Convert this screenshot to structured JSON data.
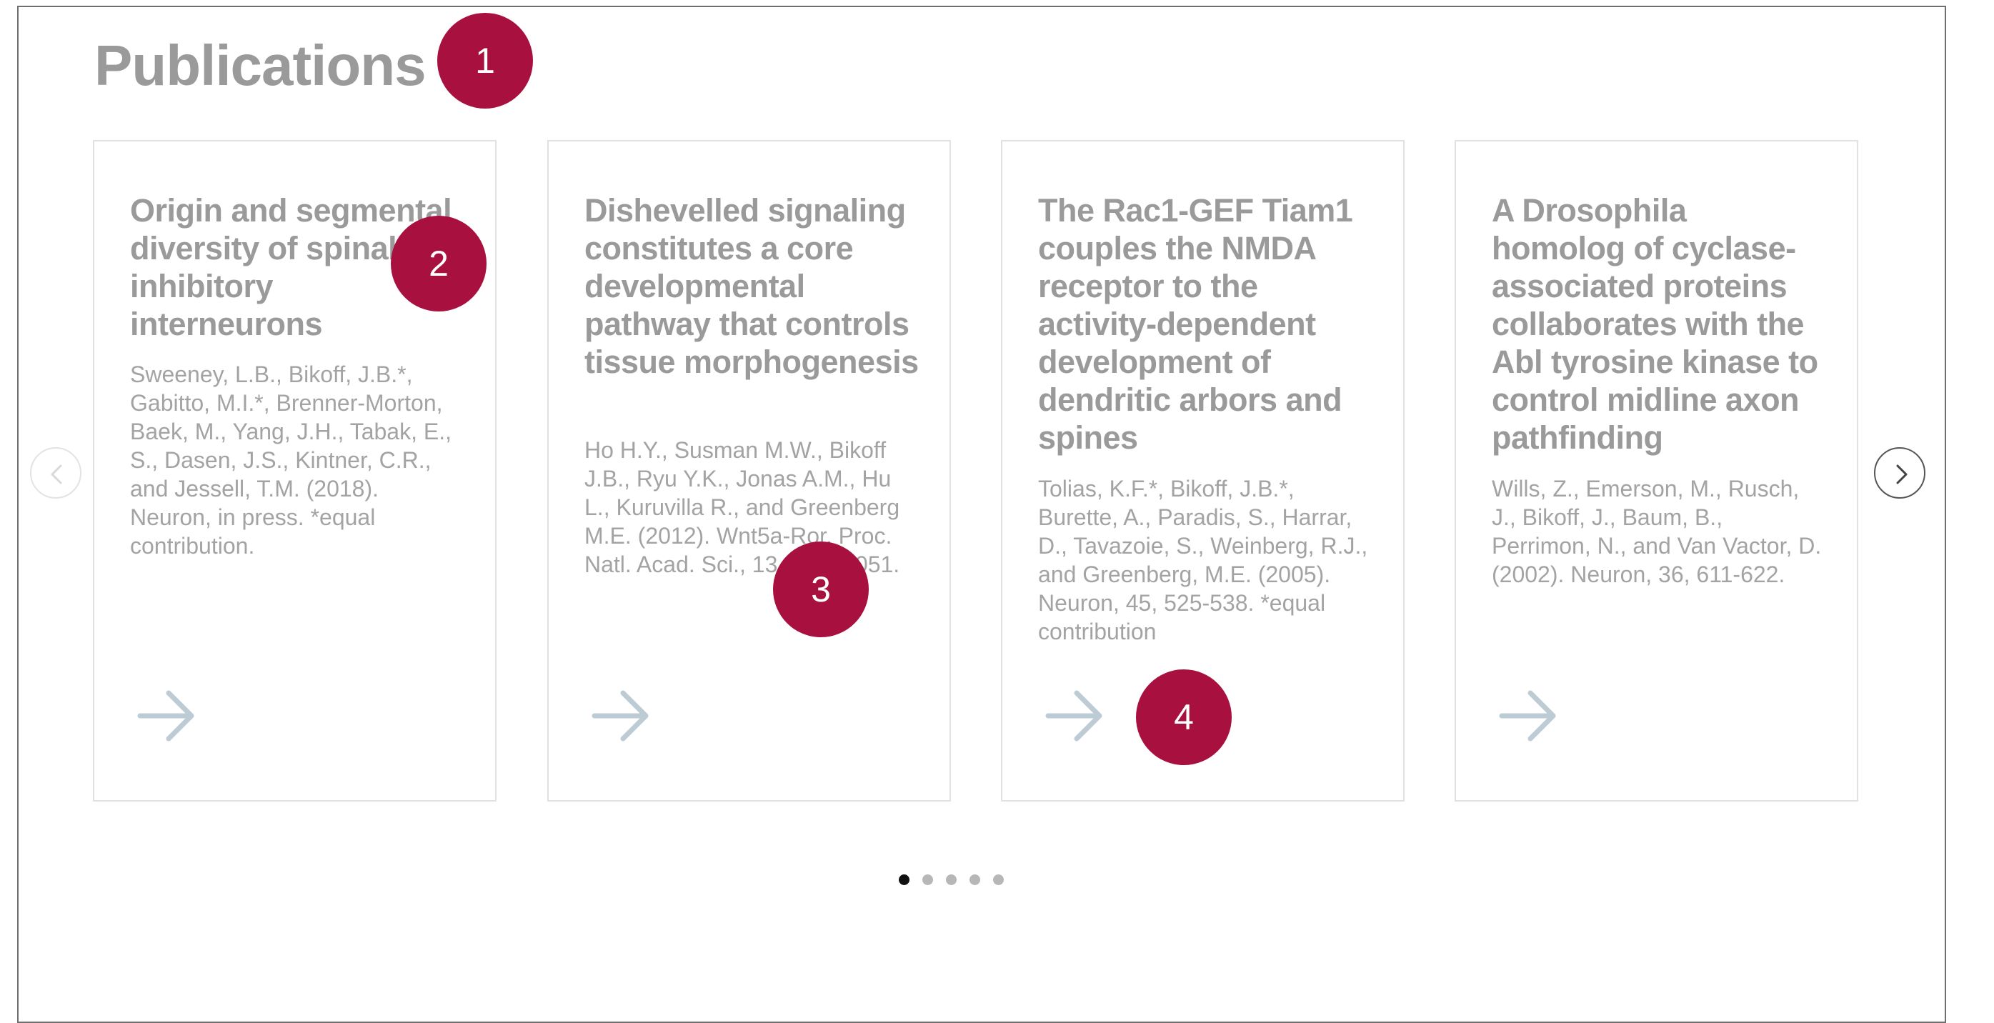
{
  "section": {
    "title": "Publications"
  },
  "publications": [
    {
      "title": "Origin and segmental diversity of spinal inhibitory interneurons",
      "citation": "Sweeney, L.B., Bikoff, J.B.*, Gabitto, M.I.*, Brenner-Morton, Baek, M., Yang, J.H., Tabak, E., S., Dasen, J.S., Kintner, C.R., and Jessell, T.M. (2018). Neuron, in press. *equal contribution."
    },
    {
      "title": "Dishevelled signaling constitutes a core developmental pathway that controls tissue morphogenesis",
      "citation": "Ho H.Y., Susman M.W., Bikoff J.B., Ryu Y.K., Jonas A.M., Hu L., Kuruvilla R., and Greenberg M.E. (2012). Wnt5a-Ror. Proc. Natl. Acad. Sci., 13 4044-4051."
    },
    {
      "title": "The Rac1-GEF Tiam1 couples the NMDA receptor to the activity-dependent development of dendritic arbors and spines",
      "citation": "Tolias, K.F.*, Bikoff, J.B.*, Burette, A., Paradis, S., Harrar, D., Tavazoie, S., Weinberg, R.J., and Greenberg, M.E. (2005). Neuron, 45, 525-538. *equal contribution"
    },
    {
      "title": "A Drosophila homolog of cyclase-associated proteins collaborates with the Abl tyrosine kinase to control midline axon pathfinding",
      "citation": "Wills, Z., Emerson, M., Rusch, J., Bikoff, J., Baum, B., Perrimon, N., and Van Vactor, D. (2002). Neuron, 36, 611-622."
    }
  ],
  "carousel": {
    "page_count": 5,
    "active_page": 1
  },
  "icons": {
    "read_more": "arrow-right-icon",
    "previous": "chevron-left-icon",
    "next": "chevron-right-icon"
  },
  "markers": [
    "1",
    "2",
    "3",
    "4"
  ],
  "colors": {
    "marker": "#a8103f",
    "arrow": "#bccbd4",
    "title_text": "#9a9a9a",
    "dot_active": "#111111",
    "dot_inactive": "#b7b7b7"
  }
}
